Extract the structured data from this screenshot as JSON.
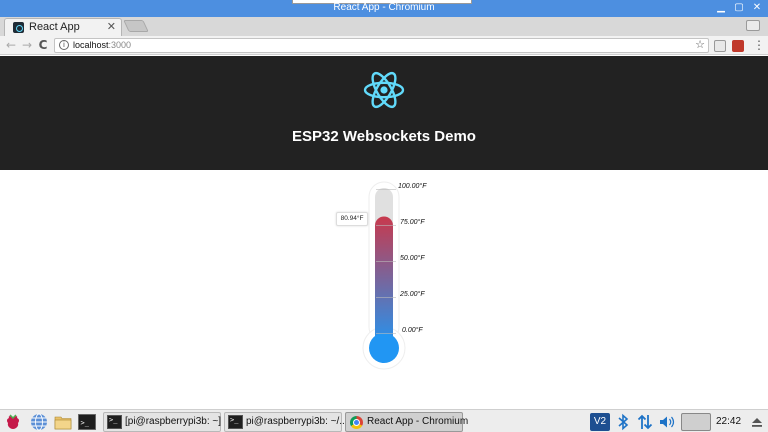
{
  "window": {
    "title": "React App - Chromium",
    "minimize": "▁",
    "maximize": "▢",
    "close": "✕"
  },
  "tab": {
    "label": "React App",
    "close": "✕"
  },
  "toolbar": {
    "back": "←",
    "forward": "→",
    "reload": "C",
    "menu": "⋮",
    "star": "☆"
  },
  "omnibox": {
    "host": "localhost",
    "port": ":3000",
    "info": "i"
  },
  "header": {
    "title": "ESP32 Websockets Demo",
    "logo_icon": "react-atom-icon"
  },
  "thermometer": {
    "current_value": "80.94°F",
    "current": 80.94,
    "min": 0,
    "max": 100,
    "ticks": [
      "100.00°F",
      "75.00°F",
      "50.00°F",
      "25.00°F",
      "0.00°F"
    ],
    "colors": {
      "top": "#c8394d",
      "bottom": "#2196f3",
      "tube": "#e0e0e0"
    }
  },
  "taskbar": {
    "tasks": [
      {
        "label": "[pi@raspberrypi3b: ~]"
      },
      {
        "label": "pi@raspberrypi3b: ~/..."
      },
      {
        "label": "React App - Chromium"
      }
    ],
    "clock": "22:42",
    "vnc_label": "V2"
  }
}
